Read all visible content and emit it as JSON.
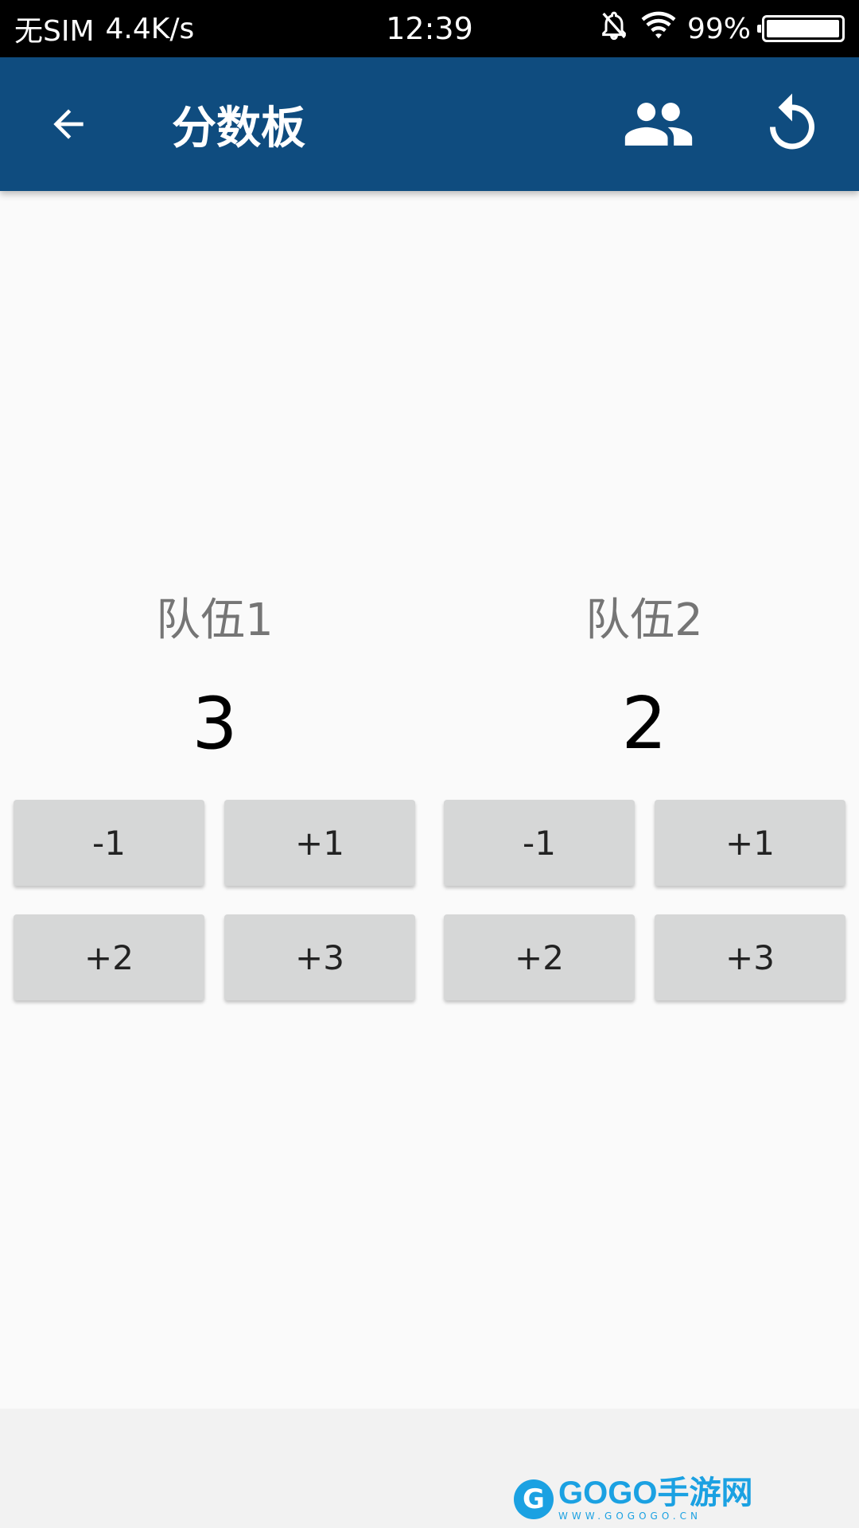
{
  "status_bar": {
    "carrier": "无SIM",
    "speed": "4.4K/s",
    "time": "12:39",
    "battery": "99%",
    "battery_level": 0.99,
    "icons": [
      "mute-bell-icon",
      "wifi-icon",
      "battery-icon"
    ]
  },
  "app_bar": {
    "title": "分数板",
    "background": "#0f4c7f",
    "icons": [
      "back-arrow-icon",
      "people-icon",
      "reset-icon"
    ]
  },
  "teams": [
    {
      "name": "队伍1",
      "score": "3",
      "buttons": [
        "-1",
        "+1",
        "+2",
        "+3"
      ]
    },
    {
      "name": "队伍2",
      "score": "2",
      "buttons": [
        "-1",
        "+1",
        "+2",
        "+3"
      ]
    }
  ],
  "watermark": {
    "logo_letter": "G",
    "text": "GOGO手游网",
    "subtext": "WWW.GOGOGO.CN"
  }
}
